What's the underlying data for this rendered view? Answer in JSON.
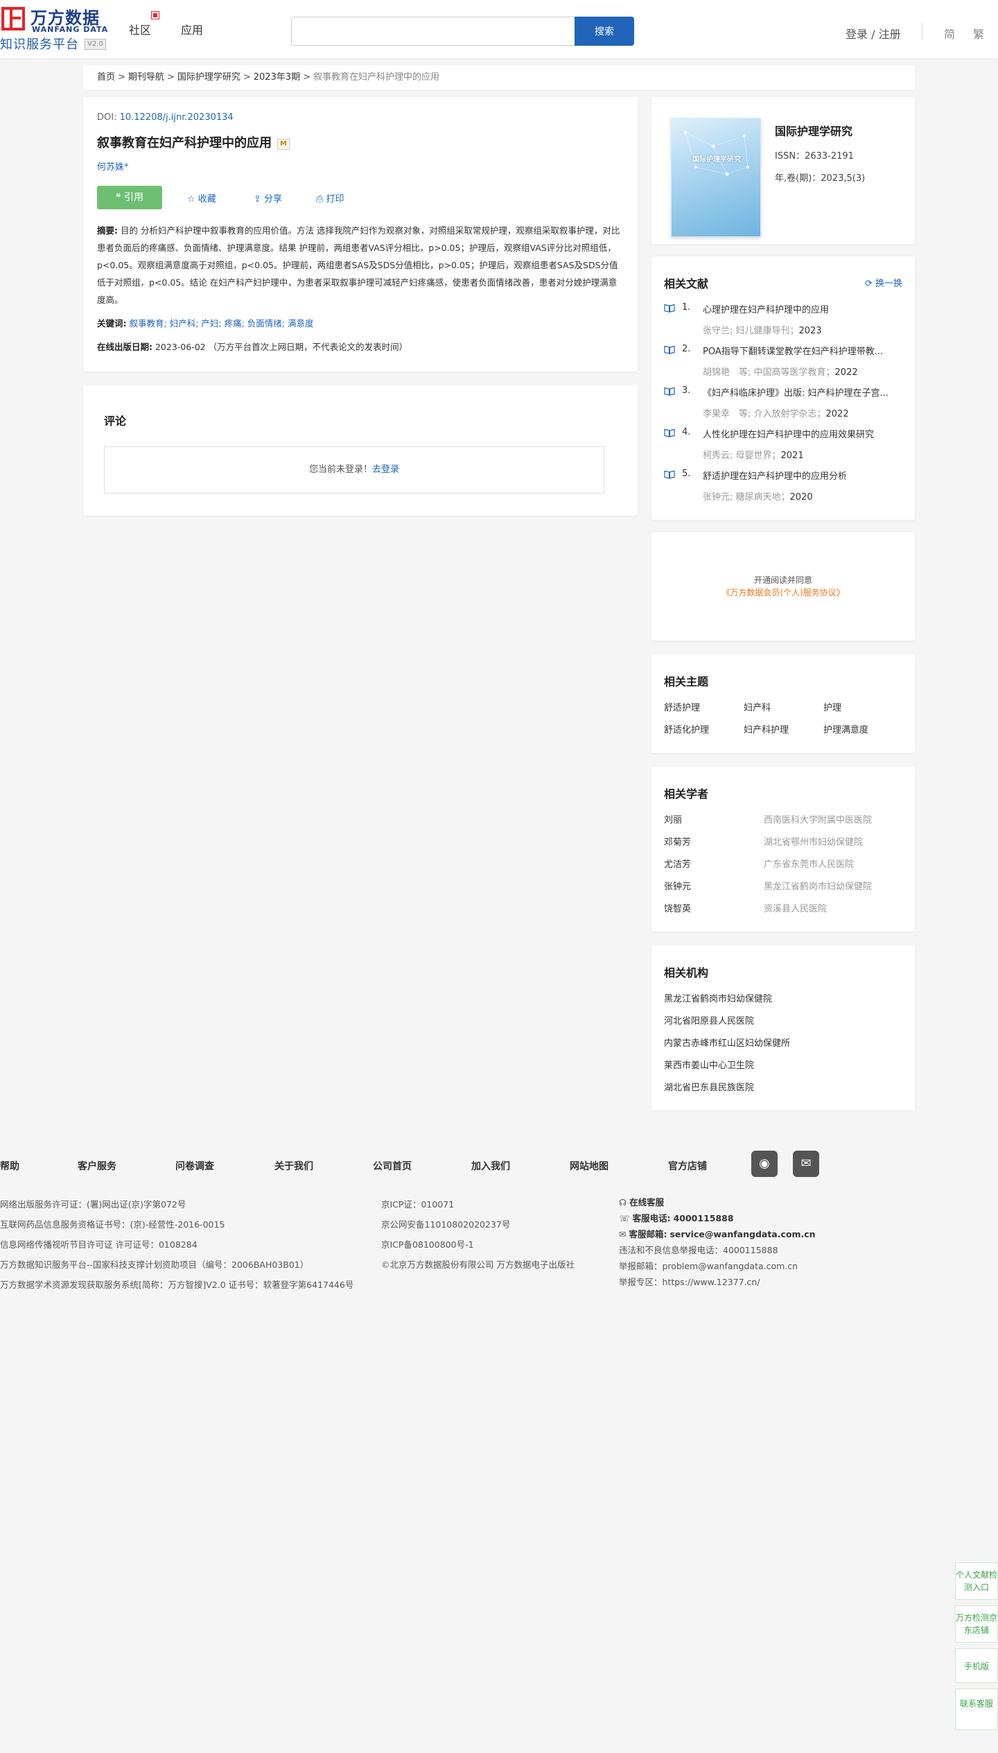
{
  "brand": {
    "cn": "万方数据",
    "en": "WANFANG DATA",
    "sub": "知识服务平台",
    "version": "V2.0"
  },
  "nav": {
    "community": "社区",
    "apps": "应用"
  },
  "search": {
    "placeholder": "",
    "button": "搜索"
  },
  "account": {
    "login": "登录 / 注册",
    "lang_simplified": "简",
    "lang_traditional": "繁"
  },
  "breadcrumb": {
    "home": "首页",
    "journals": "期刊导航",
    "journal": "国际护理学研究",
    "issue": "2023年3期",
    "current": "叙事教育在妇产科护理中的应用",
    "sep": ">"
  },
  "article": {
    "doi_label": "DOI:",
    "doi": "10.12208/j.ijnr.20230134",
    "title": "叙事教育在妇产科护理中的应用",
    "badge": "M",
    "author": "何苏姝*",
    "cite": "引用",
    "favorite": "收藏",
    "share": "分享",
    "print": "打印",
    "abstract_label": "摘要:",
    "abstract": "目的 分析妇产科护理中叙事教育的应用价值。方法 选择我院产妇作为观察对象，对照组采取常规护理，观察组采取叙事护理，对比患者负面后的疼痛感、负面情绪、护理满意度。结果 护理前，两组患者VAS评分相比，p>0.05；护理后，观察组VAS评分比对照组低，p<0.05。观察组满意度高于对照组，p<0.05。护理前，两组患者SAS及SDS分值相比，p>0.05；护理后，观察组患者SAS及SDS分值低于对照组，p<0.05。结论 在妇产科产妇护理中，为患者采取叙事护理可减轻产妇疼痛感，使患者负面情绪改善，患者对分娩护理满意度高。",
    "keywords_label": "关键词:",
    "keywords": [
      "叙事教育;",
      "妇产科;",
      "产妇;",
      "疼痛;",
      "负面情绪;",
      "满意度"
    ],
    "pubdate_label": "在线出版日期:",
    "pubdate": "2023-06-02",
    "pubdate_note": "（万方平台首次上网日期，不代表论文的发表时间）"
  },
  "comments": {
    "title": "评论",
    "not_logged": "您当前未登录！",
    "login_link": "去登录"
  },
  "journal": {
    "cover_title": "国际护理学研究",
    "name": "国际护理学研究",
    "issn": "ISSN：2633-2191",
    "year": "年,卷(期)：2023,5(3)"
  },
  "related": {
    "title": "相关文献",
    "refresh": "换一换",
    "items": [
      {
        "num": "1.",
        "title": "心理护理在妇产科护理中的应用",
        "meta": "张守兰; 妇儿健康导刊；",
        "year": "2023"
      },
      {
        "num": "2.",
        "title": "POA指导下翻转课堂教学在妇产科护理带教...",
        "meta": "胡锦艳　等;  中国高等医学教育；",
        "year": "2022"
      },
      {
        "num": "3.",
        "title": "《妇产科临床护理》出版: 妇产科护理在子宫...",
        "meta": "李果幸　等;  介入放射学杂志；",
        "year": "2022"
      },
      {
        "num": "4.",
        "title": "人性化护理在妇产科护理中的应用效果研究",
        "meta": "柯秀云; 母婴世界；",
        "year": "2021"
      },
      {
        "num": "5.",
        "title": "舒适护理在妇产科护理中的应用分析",
        "meta": "张钟元; 糖尿病天地；",
        "year": "2020"
      }
    ]
  },
  "agreement": {
    "line1": "开通阅读并同意",
    "line2": "《万方数据会员(个人)服务协议》"
  },
  "topics": {
    "title": "相关主题",
    "items": [
      "舒适护理",
      "妇产科",
      "护理",
      "舒适化护理",
      "妇产科护理",
      "护理满意度"
    ]
  },
  "scholars": {
    "title": "相关学者",
    "items": [
      {
        "name": "刘丽",
        "org": "西南医科大学附属中医医院"
      },
      {
        "name": "邓菊芳",
        "org": "湖北省鄂州市妇幼保健院"
      },
      {
        "name": "尤洁芳",
        "org": "广东省东莞市人民医院"
      },
      {
        "name": "张钟元",
        "org": "黑龙江省鹤岗市妇幼保健院"
      },
      {
        "name": "饶智英",
        "org": "资溪县人民医院"
      }
    ]
  },
  "institutions": {
    "title": "相关机构",
    "items": [
      "黑龙江省鹤岗市妇幼保健院",
      "河北省阳原县人民医院",
      "内蒙古赤峰市红山区妇幼保健所",
      "莱西市姜山中心卫生院",
      "湖北省巴东县民族医院"
    ]
  },
  "footer": {
    "links": [
      "帮助",
      "客户服务",
      "问卷调查",
      "关于我们",
      "公司首页",
      "加入我们",
      "网站地图",
      "官方店铺"
    ],
    "col1": [
      "网络出版服务许可证：(署)网出证(京)字第072号",
      "互联网药品信息服务资格证书号：(京)-经营性-2016-0015",
      "信息网络传播视听节目许可证 许可证号：0108284",
      "万方数据知识服务平台--国家科技支撑计划资助项目（编号：2006BAH03B01）",
      "万方数据学术资源发现获取服务系统[简称：万方智搜]V2.0 证书号：软著登字第6417446号"
    ],
    "col2": [
      "京ICP证：010071",
      "京公网安备11010802020237号",
      "京ICP备08100800号-1",
      "©北京万方数据股份有限公司 万方数据电子出版社"
    ],
    "service_online": "在线客服",
    "service_phone_label": "客服电话:",
    "service_phone": "4000115888",
    "service_email_label": "客服邮箱:",
    "service_email": "service@wanfangdata.com.cn",
    "report_phone": "违法和不良信息举报电话：4000115888",
    "report_email": "举报邮箱：problem@wanfangdata.com.cn",
    "report_site": "举报专区：https://www.12377.cn/"
  },
  "float": {
    "personal": "个人文献检测入口",
    "jd": "万方检测京东店铺",
    "mobile": "手机版",
    "contact": "联系客服"
  }
}
